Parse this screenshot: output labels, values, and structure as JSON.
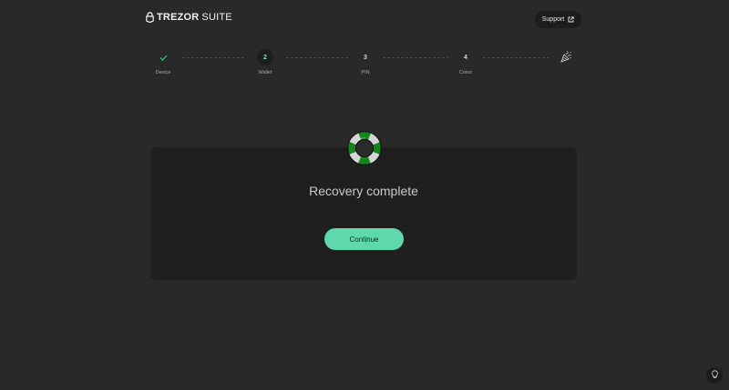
{
  "header": {
    "brand": "TREZOR",
    "suite": "SUITE",
    "support_label": "Support",
    "support_icon": "external-link-icon"
  },
  "stepper": {
    "steps": [
      {
        "marker": "✓",
        "label": "Device",
        "state": "done"
      },
      {
        "marker": "2",
        "label": "Wallet",
        "state": "active"
      },
      {
        "marker": "3",
        "label": "PIN",
        "state": "upcoming"
      },
      {
        "marker": "4",
        "label": "Coins",
        "state": "upcoming"
      }
    ],
    "final_icon": "party-popper-icon"
  },
  "main": {
    "illustration": "lifebuoy-icon",
    "title": "Recovery complete",
    "continue_label": "Continue"
  },
  "footer": {
    "corner_icon": "lightbulb-icon"
  },
  "colors": {
    "background": "#292929",
    "card": "#1f1f1f",
    "accent": "#5fd8ac",
    "check": "#2fbf71",
    "lifebuoy_green": "#13851a"
  }
}
